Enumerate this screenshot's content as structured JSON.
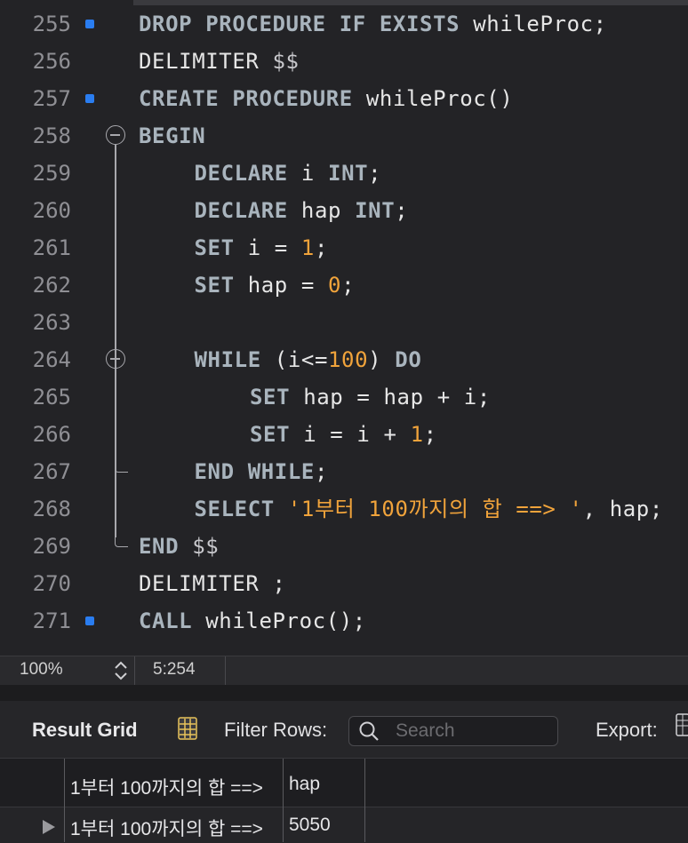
{
  "editor": {
    "lines": [
      {
        "num": "255",
        "marker": true,
        "fold": "",
        "indent": 0,
        "tokens": [
          {
            "t": "DROP PROCEDURE IF EXISTS ",
            "c": "kw"
          },
          {
            "t": "whileProc;",
            "c": ""
          }
        ]
      },
      {
        "num": "256",
        "marker": false,
        "fold": "",
        "indent": 0,
        "tokens": [
          {
            "t": "DELIMITER ",
            "c": ""
          },
          {
            "t": "$$",
            "c": "op"
          }
        ]
      },
      {
        "num": "257",
        "marker": true,
        "fold": "",
        "indent": 0,
        "tokens": [
          {
            "t": "CREATE PROCEDURE ",
            "c": "kw"
          },
          {
            "t": "whileProc()",
            "c": ""
          }
        ]
      },
      {
        "num": "258",
        "marker": false,
        "fold": "open",
        "indent": 0,
        "tokens": [
          {
            "t": "BEGIN",
            "c": "kw"
          }
        ]
      },
      {
        "num": "259",
        "marker": false,
        "fold": "",
        "indent": 1,
        "tokens": [
          {
            "t": "DECLARE ",
            "c": "kw"
          },
          {
            "t": "i ",
            "c": ""
          },
          {
            "t": "INT",
            "c": "kw"
          },
          {
            "t": ";",
            "c": ""
          }
        ]
      },
      {
        "num": "260",
        "marker": false,
        "fold": "",
        "indent": 1,
        "tokens": [
          {
            "t": "DECLARE ",
            "c": "kw"
          },
          {
            "t": "hap ",
            "c": ""
          },
          {
            "t": "INT",
            "c": "kw"
          },
          {
            "t": ";",
            "c": ""
          }
        ]
      },
      {
        "num": "261",
        "marker": false,
        "fold": "",
        "indent": 1,
        "tokens": [
          {
            "t": "SET ",
            "c": "kw"
          },
          {
            "t": "i = ",
            "c": ""
          },
          {
            "t": "1",
            "c": "num"
          },
          {
            "t": ";",
            "c": ""
          }
        ]
      },
      {
        "num": "262",
        "marker": false,
        "fold": "",
        "indent": 1,
        "tokens": [
          {
            "t": "SET ",
            "c": "kw"
          },
          {
            "t": "hap = ",
            "c": ""
          },
          {
            "t": "0",
            "c": "num"
          },
          {
            "t": ";",
            "c": ""
          }
        ]
      },
      {
        "num": "263",
        "marker": false,
        "fold": "",
        "indent": 0,
        "tokens": []
      },
      {
        "num": "264",
        "marker": false,
        "fold": "open",
        "indent": 1,
        "tokens": [
          {
            "t": "WHILE ",
            "c": "kw"
          },
          {
            "t": "(i<=",
            "c": ""
          },
          {
            "t": "100",
            "c": "num"
          },
          {
            "t": ") ",
            "c": ""
          },
          {
            "t": "DO",
            "c": "kw"
          }
        ]
      },
      {
        "num": "265",
        "marker": false,
        "fold": "",
        "indent": 2,
        "tokens": [
          {
            "t": "SET ",
            "c": "kw"
          },
          {
            "t": "hap = hap + i;",
            "c": ""
          }
        ]
      },
      {
        "num": "266",
        "marker": false,
        "fold": "",
        "indent": 2,
        "tokens": [
          {
            "t": "SET ",
            "c": "kw"
          },
          {
            "t": "i = i + ",
            "c": ""
          },
          {
            "t": "1",
            "c": "num"
          },
          {
            "t": ";",
            "c": ""
          }
        ]
      },
      {
        "num": "267",
        "marker": false,
        "fold": "end",
        "indent": 1,
        "tokens": [
          {
            "t": "END WHILE",
            "c": "kw"
          },
          {
            "t": ";",
            "c": ""
          }
        ]
      },
      {
        "num": "268",
        "marker": false,
        "fold": "",
        "indent": 1,
        "tokens": [
          {
            "t": "SELECT ",
            "c": "kw"
          },
          {
            "t": "'1부터 100까지의 합 ==> '",
            "c": "str"
          },
          {
            "t": ", hap;",
            "c": ""
          }
        ]
      },
      {
        "num": "269",
        "marker": false,
        "fold": "end",
        "indent": 0,
        "tokens": [
          {
            "t": "END ",
            "c": "kw"
          },
          {
            "t": "$$",
            "c": "op"
          }
        ]
      },
      {
        "num": "270",
        "marker": false,
        "fold": "",
        "indent": 0,
        "tokens": [
          {
            "t": "DELIMITER ;",
            "c": ""
          }
        ]
      },
      {
        "num": "271",
        "marker": true,
        "fold": "",
        "indent": 0,
        "tokens": [
          {
            "t": "CALL ",
            "c": "kw"
          },
          {
            "t": "whileProc();",
            "c": ""
          }
        ]
      }
    ]
  },
  "status": {
    "zoom": "100%",
    "position": "5:254"
  },
  "toolbar": {
    "title": "Result Grid",
    "filter_label": "Filter Rows:",
    "search_placeholder": "Search",
    "export_label": "Export:"
  },
  "grid": {
    "columns": [
      "1부터 100까지의 합 ==>",
      "hap"
    ],
    "rows": [
      [
        "1부터 100까지의 합 ==>",
        "5050"
      ]
    ]
  },
  "colors": {
    "keyword": "#a9b4bd",
    "number": "#f0a33b",
    "marker": "#2a7df0",
    "background": "#232326"
  }
}
